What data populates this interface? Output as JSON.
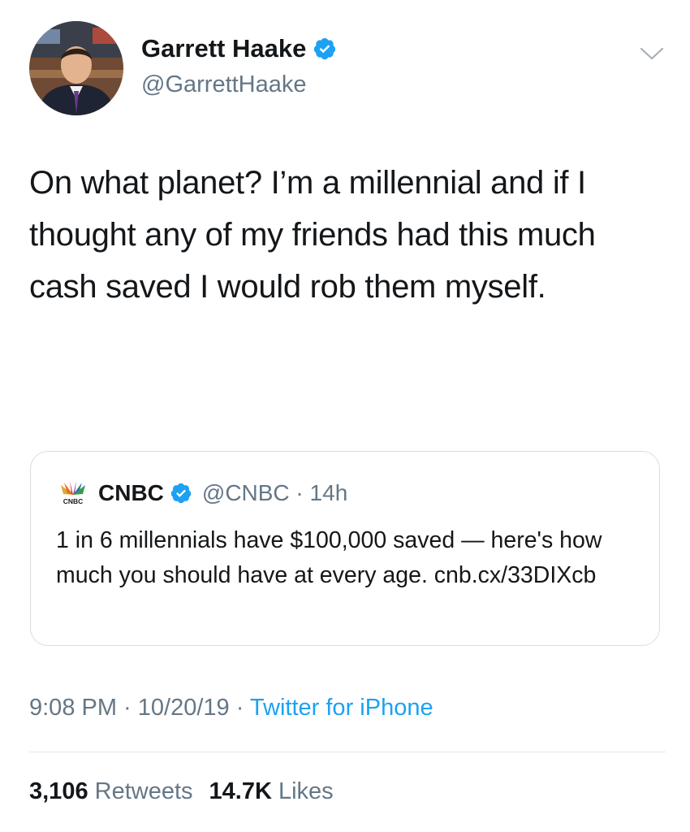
{
  "author": {
    "name": "Garrett Haake",
    "handle": "@GarrettHaake"
  },
  "tweet": {
    "text": "On what planet? I’m a millennial and if I thought any of my friends had this much cash saved I would rob them myself."
  },
  "quoted_tweet": {
    "name": "CNBC",
    "handle": "@CNBC",
    "separator": " · ",
    "time": "14h",
    "text": "1 in 6 millennials have $100,000 saved — here's how much you should have at every age. cnb.cx/33DIXcb"
  },
  "meta": {
    "time": "9:08 PM",
    "separator1": " · ",
    "date": "10/20/19",
    "separator2": " · ",
    "source": "Twitter for iPhone"
  },
  "stats": {
    "retweets_count": "3,106",
    "retweets_label": "Retweets",
    "likes_count": "14.7K",
    "likes_label": "Likes"
  },
  "icons": {
    "verified": "verified-badge-icon",
    "chevron": "chevron-down-icon",
    "cnbc_logo": "cnbc-peacock-logo"
  },
  "colors": {
    "verified_blue": "#1da1f2",
    "link_blue": "#1da1f2",
    "muted_gray": "#657786",
    "text_dark": "#14171a"
  }
}
